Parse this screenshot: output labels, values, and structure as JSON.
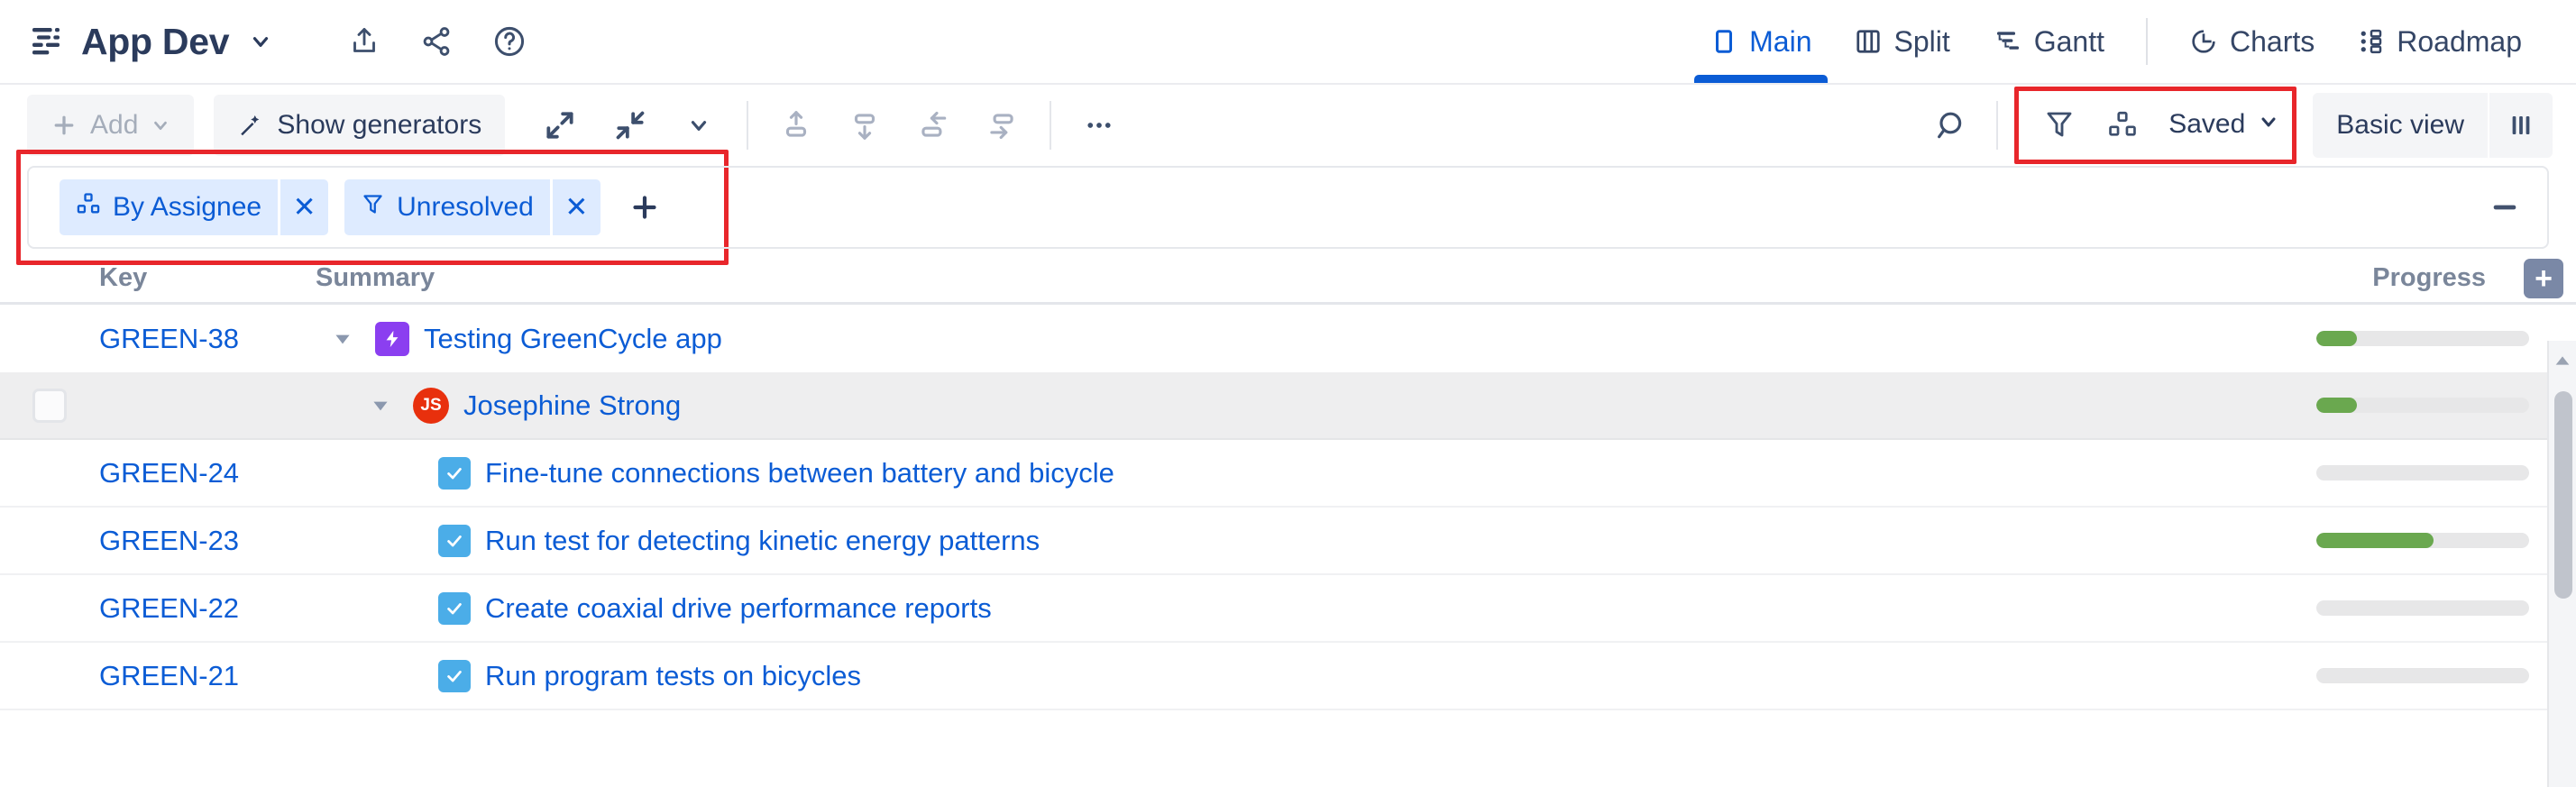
{
  "header": {
    "project_title": "App Dev",
    "project_icon": "project-structure-icon",
    "caret_icon": "chevron-down-icon",
    "actions": [
      {
        "name": "export-icon",
        "label": "Export"
      },
      {
        "name": "share-icon",
        "label": "Share"
      },
      {
        "name": "help-icon",
        "label": "Help"
      }
    ],
    "nav": [
      {
        "label": "Main",
        "icon": "main-view-icon",
        "active": true
      },
      {
        "label": "Split",
        "icon": "split-view-icon",
        "active": false
      },
      {
        "label": "Gantt",
        "icon": "gantt-view-icon",
        "active": false
      },
      {
        "label": "Charts",
        "icon": "charts-view-icon",
        "active": false
      },
      {
        "label": "Roadmap",
        "icon": "roadmap-view-icon",
        "active": false
      }
    ]
  },
  "toolbar": {
    "add_label": "Add",
    "add_caret": "chevron-down-icon",
    "generators_label": "Show generators",
    "generators_icon": "magic-wand-icon",
    "expand_icon": "expand-all-icon",
    "collapse_icon": "collapse-all-icon",
    "expand_caret_icon": "chevron-down-icon",
    "move_up_icon": "move-up-icon",
    "move_down_icon": "move-down-icon",
    "outdent_icon": "outdent-icon",
    "indent_icon": "indent-icon",
    "more_icon": "more-options-icon",
    "search_icon": "search-icon",
    "filter_icon": "filter-icon",
    "group_icon": "group-by-icon",
    "saved_label": "Saved",
    "saved_caret": "chevron-down-icon",
    "basic_view_label": "Basic view",
    "columns_icon": "columns-icon",
    "highlight_color": "#e8262b"
  },
  "filter_bar": {
    "chips": [
      {
        "label": "By Assignee",
        "icon": "group-by-icon",
        "remove_label": "✕"
      },
      {
        "label": "Unresolved",
        "icon": "filter-icon",
        "remove_label": "✕"
      }
    ],
    "add_label": "+",
    "collapse_label": "—",
    "highlight_color": "#e8262b"
  },
  "table": {
    "columns": {
      "key": "Key",
      "summary": "Summary",
      "progress": "Progress"
    },
    "add_column_label": "+",
    "rows": [
      {
        "kind": "epic",
        "key": "GREEN-38",
        "summary": "Testing GreenCycle app",
        "type_icon": "epic-icon",
        "twisty": "collapse-triangle-icon",
        "progress": 19,
        "selected": false,
        "checkbox": false
      },
      {
        "kind": "group",
        "key": "",
        "summary": "Josephine Strong",
        "avatar_initials": "JS",
        "type_icon": "avatar-icon",
        "twisty": "collapse-triangle-icon",
        "progress": 19,
        "selected": true,
        "checkbox": true
      },
      {
        "kind": "task",
        "key": "GREEN-24",
        "summary": "Fine-tune connections between battery and bicycle",
        "type_icon": "task-icon",
        "progress": 0,
        "selected": false,
        "checkbox": false
      },
      {
        "kind": "task",
        "key": "GREEN-23",
        "summary": "Run test for detecting kinetic energy patterns",
        "type_icon": "task-icon",
        "progress": 55,
        "selected": false,
        "checkbox": false
      },
      {
        "kind": "task",
        "key": "GREEN-22",
        "summary": "Create coaxial drive performance reports",
        "type_icon": "task-icon",
        "progress": 0,
        "selected": false,
        "checkbox": false
      },
      {
        "kind": "task",
        "key": "GREEN-21",
        "summary": "Run program tests on bicycles",
        "type_icon": "task-icon",
        "progress": 0,
        "selected": false,
        "checkbox": false
      }
    ]
  },
  "scrollbar": {
    "up_arrow": "scroll-up-arrow-icon"
  },
  "colors": {
    "link_blue": "#0b5cd5",
    "chip_bg": "#deebff",
    "progress_green": "#6aa84f",
    "epic_purple": "#8b3ff0",
    "task_blue": "#4bade8",
    "avatar_red": "#e8300d",
    "text_navy": "#2b3b5c",
    "header_grey": "#7a869a"
  }
}
